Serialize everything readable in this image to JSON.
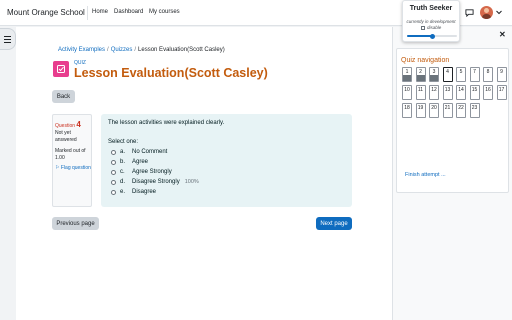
{
  "navbar": {
    "site_name": "Mount Orange School",
    "links": [
      "Home",
      "Dashboard",
      "My courses"
    ]
  },
  "breadcrumb": [
    "Activity Examples",
    "Quizzes",
    "Lesson Evaluation(Scott Casley)"
  ],
  "header": {
    "module_label": "QUIZ",
    "title": "Lesson Evaluation(Scott Casley)"
  },
  "back_button": "Back",
  "question_info": {
    "label": "Question",
    "number": "4",
    "status": "Not yet answered",
    "marked": "Marked out of 1.00",
    "flag": "Flag question"
  },
  "question": {
    "text": "The lesson activities were explained clearly.",
    "select_label": "Select one:",
    "options": [
      {
        "letter": "a.",
        "text": "No Comment",
        "pct": ""
      },
      {
        "letter": "b.",
        "text": "Agree",
        "pct": ""
      },
      {
        "letter": "c.",
        "text": "Agree Strongly",
        "pct": ""
      },
      {
        "letter": "d.",
        "text": "Disagree Strongly",
        "pct": "100%"
      },
      {
        "letter": "e.",
        "text": "Disagree",
        "pct": ""
      }
    ]
  },
  "buttons": {
    "previous": "Previous page",
    "next": "Next page"
  },
  "quiz_nav": {
    "title": "Quiz navigation",
    "buttons": [
      {
        "num": "1",
        "answered": true
      },
      {
        "num": "2",
        "answered": true
      },
      {
        "num": "3",
        "answered": true
      },
      {
        "num": "4",
        "answered": false,
        "current": true
      },
      {
        "num": "5",
        "answered": false
      },
      {
        "num": "7",
        "answered": false
      },
      {
        "num": "8",
        "answered": false
      },
      {
        "num": "9",
        "answered": false
      },
      {
        "num": "10",
        "answered": false
      },
      {
        "num": "11",
        "answered": false
      },
      {
        "num": "12",
        "answered": false
      },
      {
        "num": "13",
        "answered": false
      },
      {
        "num": "14",
        "answered": false
      },
      {
        "num": "15",
        "answered": false
      },
      {
        "num": "16",
        "answered": false
      },
      {
        "num": "17",
        "answered": false
      },
      {
        "num": "18",
        "answered": false
      },
      {
        "num": "19",
        "answered": false
      },
      {
        "num": "20",
        "answered": false
      },
      {
        "num": "21",
        "answered": false
      },
      {
        "num": "22",
        "answered": false
      },
      {
        "num": "23",
        "answered": false
      }
    ],
    "finish_link": "Finish attempt ..."
  },
  "popup": {
    "title": "Truth Seeker",
    "desc": "currently in development",
    "checkbox_label": "disable",
    "slider_level": 0.5
  },
  "colors": {
    "brand": "#0f6cbf",
    "title": "#c35c0e",
    "quiz_icon": "#e83d8e",
    "question_bg": "#e7f3f5"
  }
}
